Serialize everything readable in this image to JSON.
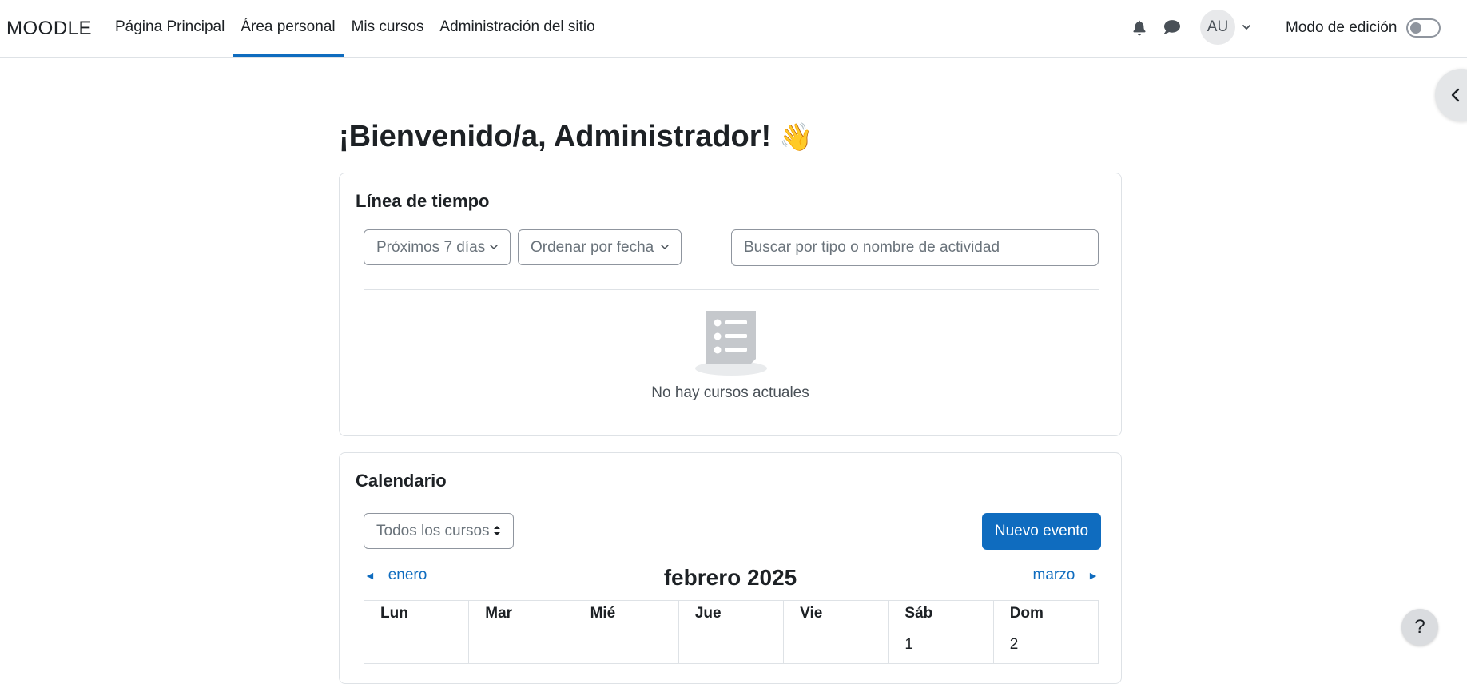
{
  "navbar": {
    "brand": "MOODLE",
    "items": [
      {
        "label": "Página Principal"
      },
      {
        "label": "Área personal"
      },
      {
        "label": "Mis cursos"
      },
      {
        "label": "Administración del sitio"
      }
    ],
    "active_item": "Área personal",
    "notifications_icon": "bell-icon",
    "messages_icon": "chat-bubble-icon",
    "avatar_initials": "AU",
    "edit_mode_label": "Modo de edición",
    "edit_mode_on": false
  },
  "page": {
    "title": "¡Bienvenido/a, Administrador!",
    "wave_emoji": "👋"
  },
  "timeline": {
    "title": "Línea de tiempo",
    "filter_label": "Próximos 7 días",
    "sort_label": "Ordenar por fecha",
    "search_placeholder": "Buscar por tipo o nombre de actividad",
    "search_value": "",
    "empty_icon": "list-placeholder-icon",
    "empty_message": "No hay cursos actuales"
  },
  "calendar": {
    "title": "Calendario",
    "course_select_label": "Todos los cursos",
    "new_event_label": "Nuevo evento",
    "prev_month_label": "enero",
    "next_month_label": "marzo",
    "month_title": "febrero 2025",
    "day_headers": [
      "Lun",
      "Mar",
      "Mié",
      "Jue",
      "Vie",
      "Sáb",
      "Dom"
    ],
    "first_week": [
      "",
      "",
      "",
      "",
      "",
      "1",
      "2"
    ]
  },
  "help_label": "?",
  "colors": {
    "primary": "#0f6cbf",
    "text": "#1d2125",
    "border": "#dee2e6"
  }
}
